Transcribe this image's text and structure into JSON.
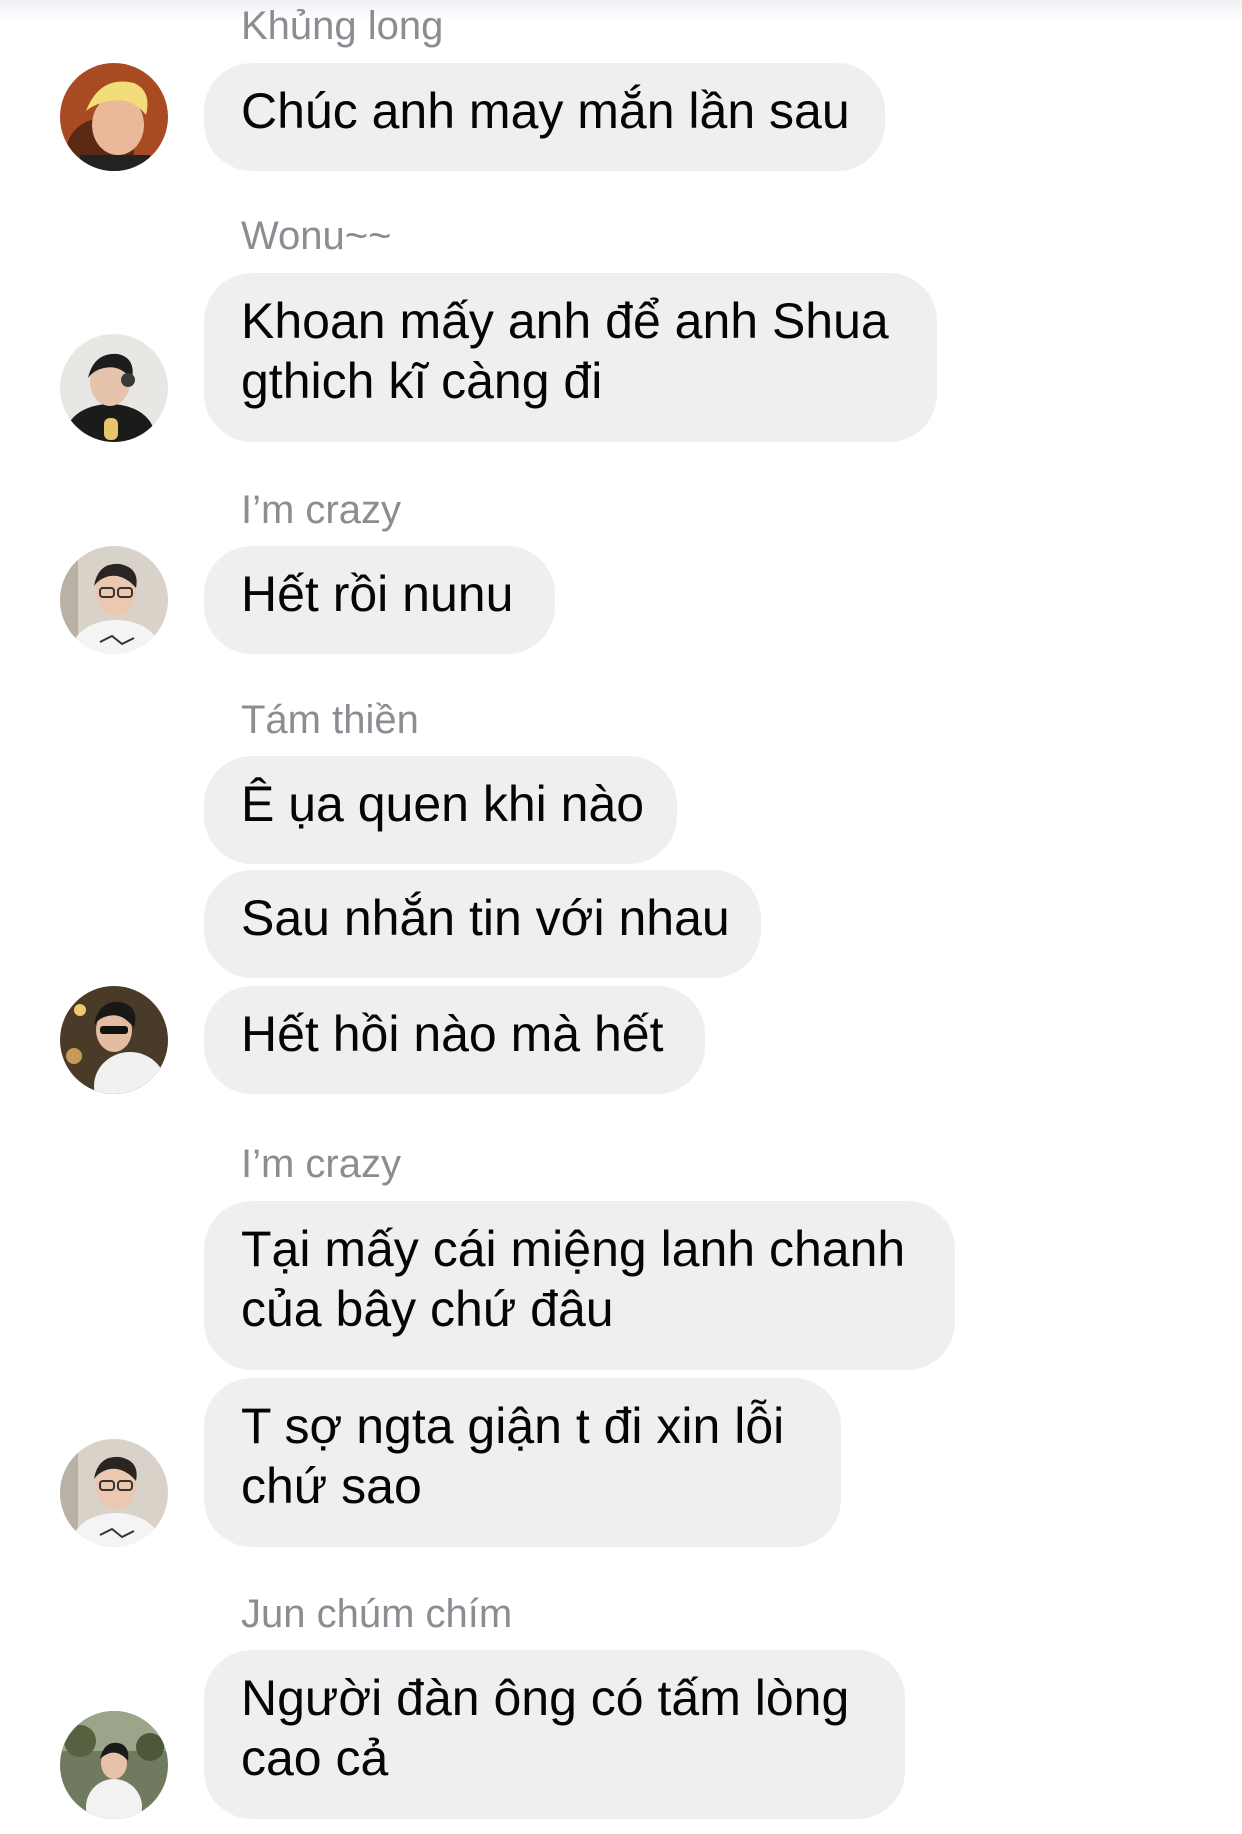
{
  "messages": [
    {
      "sender": "Khủng long",
      "bubbles": [
        [
          "Chúc anh may mắn lần sau"
        ]
      ],
      "avatar": "blonde-hair-avatar"
    },
    {
      "sender": "Wonu~~",
      "bubbles": [
        [
          "Khoan mấy anh để anh Shua",
          "gthich kĩ càng đi"
        ]
      ],
      "avatar": "headphones-avatar"
    },
    {
      "sender": "I’m crazy",
      "bubbles": [
        [
          "Hết rồi nunu"
        ]
      ],
      "avatar": "glasses-avatar"
    },
    {
      "sender": "Tám thiền",
      "bubbles": [
        [
          "Ê ụa quen khi nào"
        ],
        [
          "Sau nhắn tin với nhau"
        ],
        [
          "Hết hồi nào mà hết"
        ]
      ],
      "avatar": "sunglasses-avatar"
    },
    {
      "sender": "I’m crazy",
      "bubbles": [
        [
          "Tại mấy cái miệng lanh chanh",
          "của bây chứ đâu"
        ],
        [
          "T sợ ngta giận t đi xin lỗi",
          "chứ sao"
        ]
      ],
      "avatar": "glasses-avatar"
    },
    {
      "sender": "Jun chúm chím",
      "bubbles": [
        [
          "Người đàn ông có tấm lòng",
          "cao cả"
        ]
      ],
      "avatar": "outdoor-avatar"
    }
  ],
  "colors": {
    "bubble": "#efeff2",
    "sender_text": "#8a8d91",
    "message_text": "#050505"
  }
}
